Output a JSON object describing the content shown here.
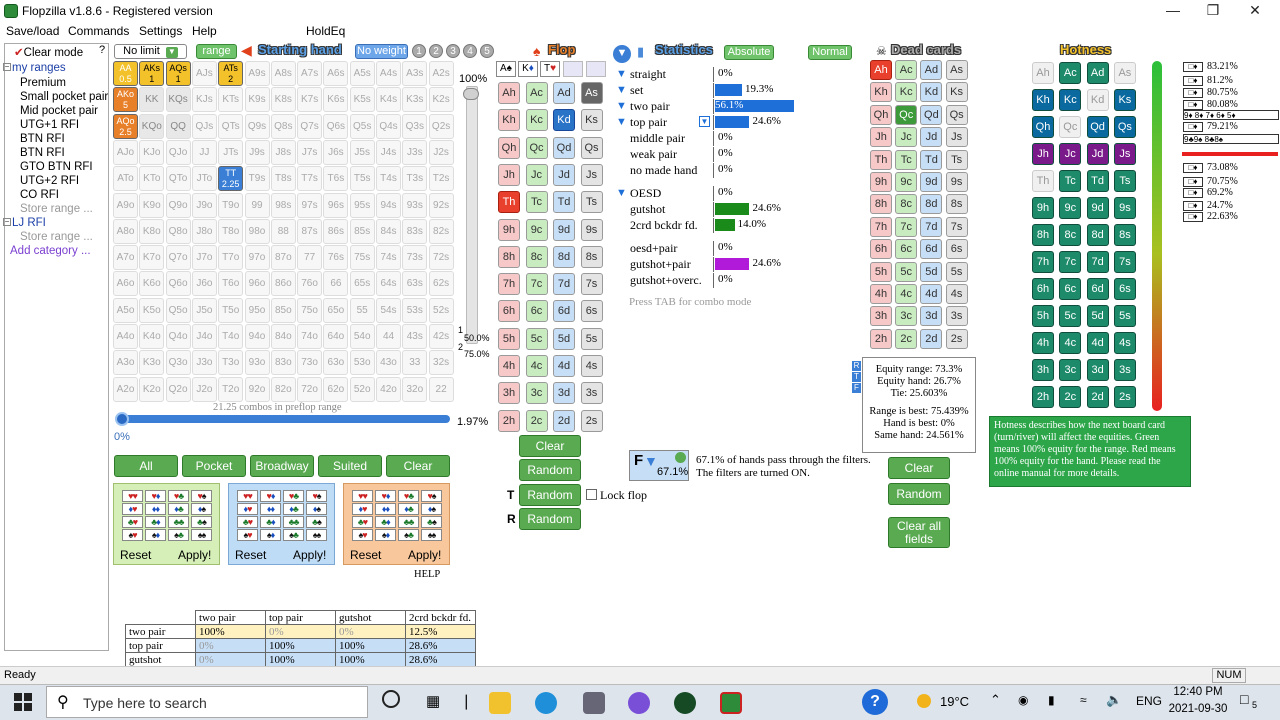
{
  "window": {
    "title": "Flopzilla v1.8.6 - Registered version"
  },
  "menu": [
    "Save/load",
    "Commands",
    "Settings",
    "Help",
    "HoldEq"
  ],
  "tree": {
    "clear_mode": "Clear mode",
    "items": [
      "my ranges",
      "Premium",
      "Small pocket pair",
      "Mid pocket pair",
      "UTG+1 RFI",
      "BTN RFI",
      "BTN RFI",
      "GTO BTN RFI",
      "UTG+2 RFI",
      "CO RFI",
      "Store range ...",
      "LJ RFI",
      "Store range ...",
      "Add category ..."
    ]
  },
  "toolbar": {
    "limit": "No limit",
    "range": "range",
    "starting_hand": "Starting hand",
    "no_weight": "No weight",
    "weights": [
      "1",
      "2",
      "3",
      "4",
      "5"
    ]
  },
  "grid": {
    "pct_top": "100%",
    "pct_mid1": "50.0%",
    "pct_mid2": "75.0%",
    "combos": "21.25 combos in preflop range",
    "pct_slider": "1.97%",
    "pct_zero": "0%",
    "rows": [
      [
        "AA",
        "AKs",
        "AQs",
        "AJs",
        "ATs",
        "A9s",
        "A8s",
        "A7s",
        "A6s",
        "A5s",
        "A4s",
        "A3s",
        "A2s"
      ],
      [
        "AKo",
        "KK",
        "KQs",
        "KJs",
        "KTs",
        "K9s",
        "K8s",
        "K7s",
        "K6s",
        "K5s",
        "K4s",
        "K3s",
        "K2s"
      ],
      [
        "AQo",
        "KQo",
        "QQ",
        "QJs",
        "QTs",
        "Q9s",
        "Q8s",
        "Q7s",
        "Q6s",
        "Q5s",
        "Q4s",
        "Q3s",
        "Q2s"
      ],
      [
        "AJo",
        "KJo",
        "QJo",
        "JJ",
        "JTs",
        "J9s",
        "J8s",
        "J7s",
        "J6s",
        "J5s",
        "J4s",
        "J3s",
        "J2s"
      ],
      [
        "ATo",
        "KTo",
        "QTo",
        "JTo",
        "TT",
        "T9s",
        "T8s",
        "T7s",
        "T6s",
        "T5s",
        "T4s",
        "T3s",
        "T2s"
      ],
      [
        "A9o",
        "K9o",
        "Q9o",
        "J9o",
        "T9o",
        "99",
        "98s",
        "97s",
        "96s",
        "95s",
        "94s",
        "93s",
        "92s"
      ],
      [
        "A8o",
        "K8o",
        "Q8o",
        "J8o",
        "T8o",
        "98o",
        "88",
        "87s",
        "86s",
        "85s",
        "84s",
        "83s",
        "82s"
      ],
      [
        "A7o",
        "K7o",
        "Q7o",
        "J7o",
        "T7o",
        "97o",
        "87o",
        "77",
        "76s",
        "75s",
        "74s",
        "73s",
        "72s"
      ],
      [
        "A6o",
        "K6o",
        "Q6o",
        "J6o",
        "T6o",
        "96o",
        "86o",
        "76o",
        "66",
        "65s",
        "64s",
        "63s",
        "62s"
      ],
      [
        "A5o",
        "K5o",
        "Q5o",
        "J5o",
        "T5o",
        "95o",
        "85o",
        "75o",
        "65o",
        "55",
        "54s",
        "53s",
        "52s"
      ],
      [
        "A4o",
        "K4o",
        "Q4o",
        "J4o",
        "T4o",
        "94o",
        "84o",
        "74o",
        "64o",
        "54o",
        "44",
        "43s",
        "42s"
      ],
      [
        "A3o",
        "K3o",
        "Q3o",
        "J3o",
        "T3o",
        "93o",
        "83o",
        "73o",
        "63o",
        "53o",
        "43o",
        "33",
        "32s"
      ],
      [
        "A2o",
        "K2o",
        "Q2o",
        "J2o",
        "T2o",
        "92o",
        "82o",
        "72o",
        "62o",
        "52o",
        "42o",
        "32o",
        "22"
      ]
    ],
    "selected": {
      "AA": "0.5",
      "AKs": "1",
      "AQs": "1",
      "ATs": "2",
      "AKo": "5",
      "AQo": "2.5",
      "TT": "2.25"
    }
  },
  "filters": [
    "All",
    "Pocket",
    "Broadway",
    "Suited",
    "Clear"
  ],
  "suitbox": {
    "reset": "Reset",
    "apply": "Apply!",
    "help": "HELP"
  },
  "flop": {
    "title": "Flop",
    "ranks": [
      "A",
      "K",
      "Q",
      "J",
      "T",
      "9",
      "8",
      "7",
      "6",
      "5",
      "4",
      "3",
      "2"
    ],
    "selected": [
      "As",
      "Kd",
      "Th"
    ],
    "buttons": {
      "clear": "Clear",
      "random": "Random",
      "lock": "Lock flop"
    }
  },
  "stats": {
    "title": "Statistics",
    "absolute": "Absolute",
    "normal": "Normal",
    "rows": [
      {
        "label": "straight",
        "val": "0%",
        "pct": 0
      },
      {
        "label": "set",
        "val": "19.3%",
        "pct": 19.3
      },
      {
        "label": "two pair",
        "val": "56.1%",
        "pct": 56.1
      },
      {
        "label": "top pair",
        "val": "24.6%",
        "pct": 24.6
      },
      {
        "label": "middle pair",
        "val": "0%",
        "pct": 0
      },
      {
        "label": "weak pair",
        "val": "0%",
        "pct": 0
      },
      {
        "label": "no made hand",
        "val": "0%",
        "pct": 0
      },
      {
        "label": "OESD",
        "val": "0%",
        "pct": 0
      },
      {
        "label": "gutshot",
        "val": "24.6%",
        "pct": 24.6
      },
      {
        "label": "2crd bckdr fd.",
        "val": "14.0%",
        "pct": 14.0
      },
      {
        "label": "oesd+pair",
        "val": "0%",
        "pct": 0
      },
      {
        "label": "gutshot+pair",
        "val": "24.6%",
        "pct": 24.6
      },
      {
        "label": "gutshot+overc.",
        "val": "0%",
        "pct": 0
      }
    ],
    "tab_hint": "Press TAB for combo mode",
    "filter_pct": "67.1%",
    "filter_text1": "67.1% of hands pass through the filters.",
    "filter_text2": "The filters are turned ON."
  },
  "dead": {
    "title": "Dead cards",
    "equity": [
      "Equity range: 73.3%",
      "Equity hand: 26.7%",
      "Tie: 25.603%",
      "Range is best: 75.439%",
      "Hand is best: 0%",
      "Same hand: 24.561%"
    ],
    "clear": "Clear",
    "random": "Random",
    "clear_all": "Clear all fields"
  },
  "hotness": {
    "title": "Hotness",
    "right_list": [
      "83.21%",
      "81.2%",
      "80.75%",
      "80.08%",
      "79.21%",
      "73.08%",
      "70.75%",
      "69.2%",
      "24.7%",
      "22.63%"
    ],
    "desc": "Hotness describes how the next board card (turn/river) will affect the equities. Green means 100% equity for the range. Red means 100% equity for the hand. Please read the online manual for more details."
  },
  "combo_table": {
    "headers": [
      "",
      "two pair",
      "top pair",
      "gutshot",
      "2crd bckdr fd."
    ],
    "rows": [
      [
        "two pair",
        "100%",
        "0%",
        "0%",
        "12.5%"
      ],
      [
        "top pair",
        "0%",
        "100%",
        "100%",
        "28.6%"
      ],
      [
        "gutshot",
        "0%",
        "100%",
        "100%",
        "28.6%"
      ]
    ]
  },
  "status": {
    "ready": "Ready",
    "num": "NUM"
  },
  "taskbar": {
    "search": "Type here to search",
    "temp": "19°C",
    "lang": "ENG",
    "time": "12:40 PM",
    "date": "2021-09-30",
    "notif": "5"
  }
}
